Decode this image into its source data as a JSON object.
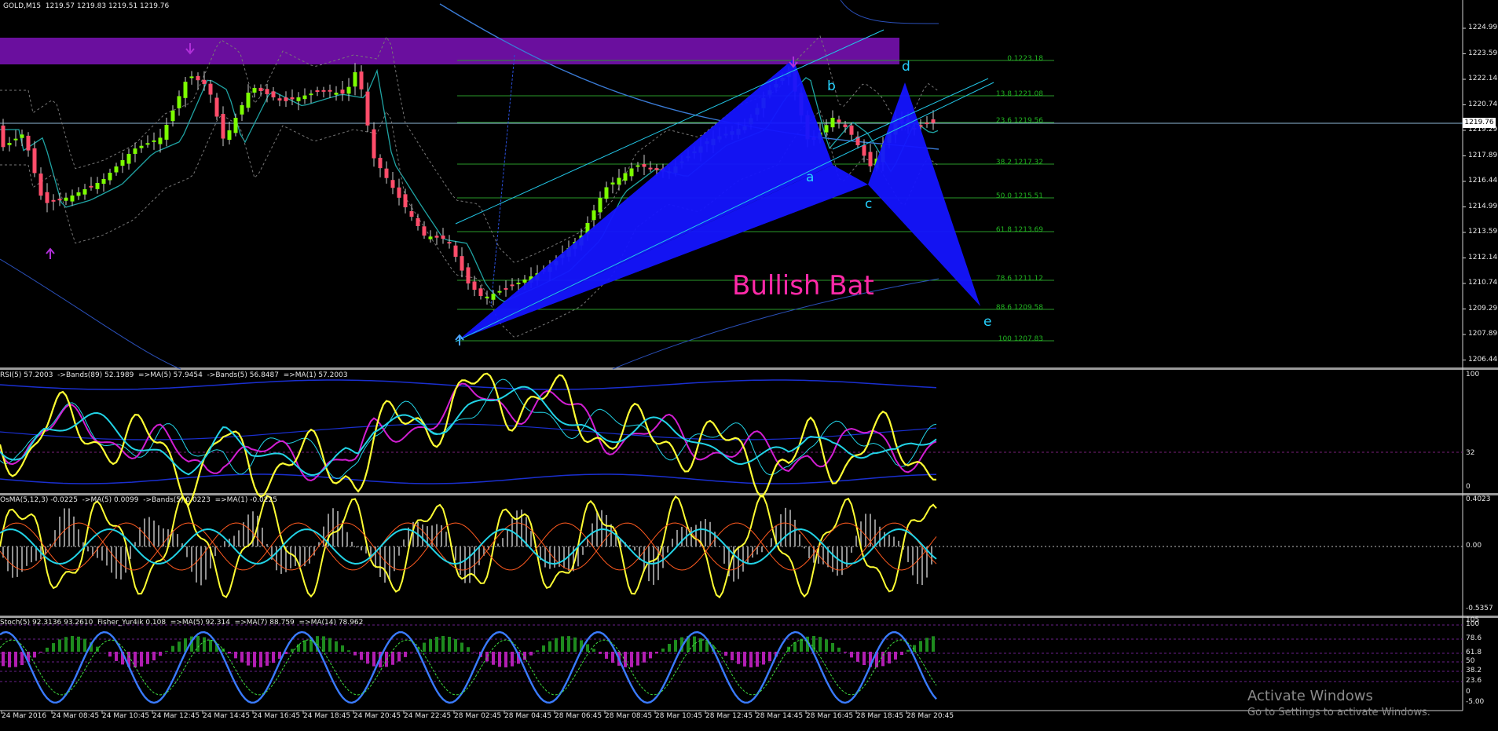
{
  "main": {
    "header": "GOLD,M15  1219.57 1219.83 1219.51 1219.76",
    "current_price": "1219.76",
    "price_ticks": [
      "1224.99",
      "1223.59",
      "1222.14",
      "1220.74",
      "1219.29",
      "1217.89",
      "1216.44",
      "1214.99",
      "1213.59",
      "1212.14",
      "1210.74",
      "1209.29",
      "1207.89",
      "1206.44"
    ],
    "fib_levels": [
      "0.1223.18",
      "13.8 1221.08",
      "23.6 1219.56",
      "38.2 1217.32",
      "50.0 1215.51",
      "61.8 1213.69",
      "78.6 1211.12",
      "88.6 1209.58",
      "100 1207.83"
    ],
    "pattern_title": "Bullish Bat",
    "points": {
      "a": "a",
      "b": "b",
      "c": "c",
      "d": "d",
      "e": "e"
    }
  },
  "rsi_panel": {
    "header": "RSI(5) 57.2003  ->Bands(89) 52.1989  =>MA(5) 57.9454  ->Bands(5) 56.8487  =>MA(1) 57.2003",
    "ticks": [
      "100",
      "32",
      "0"
    ]
  },
  "osma_panel": {
    "header": "OsMA(5,12,3) -0.0225  ->MA(5) 0.0099  ->Bands(5) 0.0223  =>MA(1) -0.0225",
    "ticks": [
      "0.4023",
      "0.00",
      "-0.5357"
    ]
  },
  "stoch_panel": {
    "header": "Stoch(5) 92.3136 93.2610  Fisher_Yur4ik 0.108  =>MA(5) 92.314  =>MA(7) 88.759  =>MA(14) 78.962",
    "ticks": [
      "105",
      "100",
      "78.6",
      "61.8",
      "50",
      "38.2",
      "23.6",
      "0",
      "-5.00"
    ]
  },
  "time_axis": [
    "24 Mar 2016",
    "24 Mar 08:45",
    "24 Mar 10:45",
    "24 Mar 12:45",
    "24 Mar 14:45",
    "24 Mar 16:45",
    "24 Mar 18:45",
    "24 Mar 20:45",
    "24 Mar 22:45",
    "28 Mar 02:45",
    "28 Mar 04:45",
    "28 Mar 06:45",
    "28 Mar 08:45",
    "28 Mar 10:45",
    "28 Mar 12:45",
    "28 Mar 14:45",
    "28 Mar 16:45",
    "28 Mar 18:45",
    "28 Mar 20:45"
  ],
  "watermark": {
    "line1": "Activate Windows",
    "line2": "Go to Settings to activate Windows."
  },
  "colors": {
    "bull": "#7cfc00",
    "bear": "#ff4d6a",
    "pattern": "#1414ff",
    "zone": "#6a0f9e",
    "fib": "#2a9a2a",
    "rsi_yellow": "#ffff33",
    "cyan": "#22d3e6",
    "magenta": "#d21ed2"
  }
}
